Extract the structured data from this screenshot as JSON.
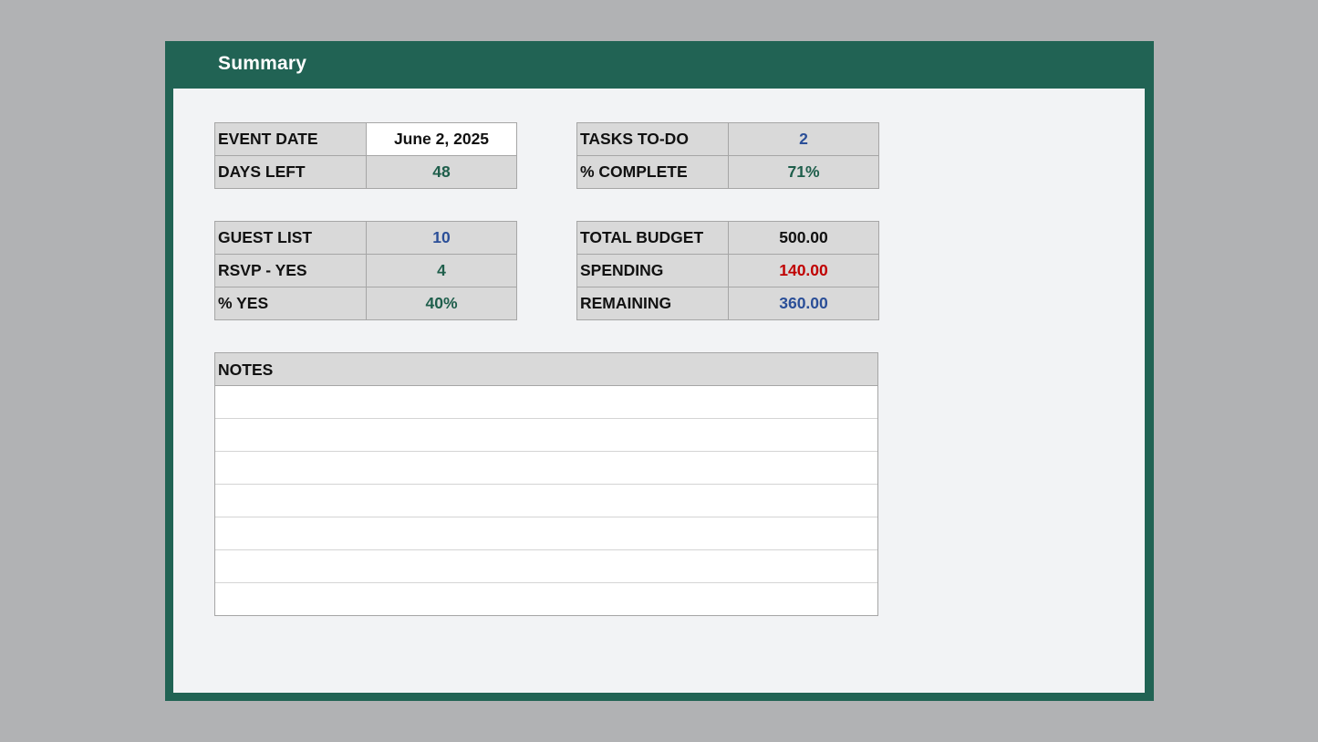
{
  "title": "Summary",
  "event": {
    "event_date_label": "EVENT DATE",
    "event_date": "June 2, 2025",
    "days_left_label": "DAYS LEFT",
    "days_left": "48"
  },
  "tasks": {
    "tasks_todo_label": "TASKS TO-DO",
    "tasks_todo": "2",
    "complete_label": "% COMPLETE",
    "complete": "71%"
  },
  "guests": {
    "guest_list_label": "GUEST LIST",
    "guest_list": "10",
    "rsvp_yes_label": "RSVP - YES",
    "rsvp_yes": "4",
    "pct_yes_label": "% YES",
    "pct_yes": "40%"
  },
  "budget": {
    "total_label": "TOTAL BUDGET",
    "total": "500.00",
    "spending_label": "SPENDING",
    "spending": "140.00",
    "remaining_label": "REMAINING",
    "remaining": "360.00"
  },
  "notes": {
    "header": "NOTES",
    "rows": [
      "",
      "",
      "",
      "",
      "",
      "",
      ""
    ]
  },
  "colors": {
    "frame": "#216354",
    "value_green": "#1e5e4b",
    "value_blue": "#2b4f98",
    "value_red": "#c00000"
  }
}
